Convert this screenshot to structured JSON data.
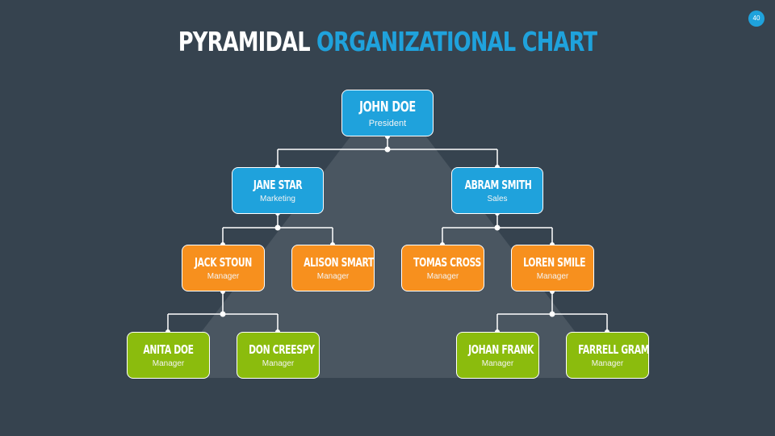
{
  "title": {
    "part1": "PYRAMIDAL",
    "part2": "ORGANIZATIONAL CHART"
  },
  "page_number": "40",
  "colors": {
    "background": "#36434f",
    "pyramid": "#4a5661",
    "level1": "#1fa2dc",
    "level2": "#1fa2dc",
    "level3": "#f7901e",
    "level4": "#8bbc0d",
    "accent": "#1fa2dc"
  },
  "org": {
    "president": {
      "name": "JOHN DOE",
      "role": "President"
    },
    "directors": [
      {
        "name": "JANE STAR",
        "role": "Marketing"
      },
      {
        "name": "ABRAM  SMITH",
        "role": "Sales"
      }
    ],
    "managers": [
      {
        "name": "JACK STOUN",
        "role": "Manager"
      },
      {
        "name": "ALISON SMART",
        "role": "Manager"
      },
      {
        "name": "TOMAS CROSS",
        "role": "Manager"
      },
      {
        "name": "LOREN SMILE",
        "role": "Manager"
      }
    ],
    "staff": [
      {
        "name": "ANITA DOE",
        "role": "Manager"
      },
      {
        "name": "DON CREESPY",
        "role": "Manager"
      },
      {
        "name": "JOHAN FRANK",
        "role": "Manager"
      },
      {
        "name": "FARRELL GRAM",
        "role": "Manager"
      }
    ]
  }
}
